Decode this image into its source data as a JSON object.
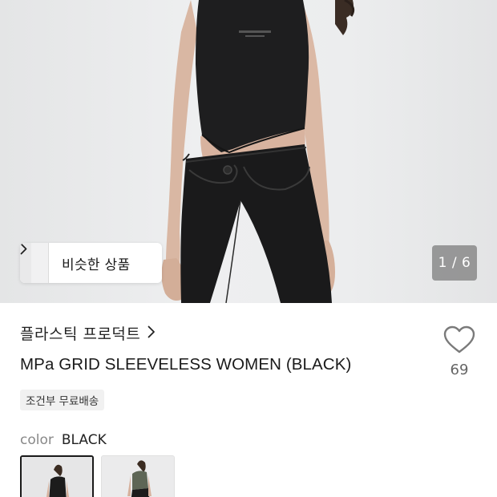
{
  "gallery": {
    "similar_label": "비슷한 상품",
    "pager": "1 / 6"
  },
  "product": {
    "brand": "플라스틱 프로덕트",
    "title": "MPa GRID SLEEVELESS WOMEN (BLACK)",
    "likes": "69",
    "shipping_badge": "조건부 무료배송"
  },
  "options": {
    "color_label": "color",
    "color_value": "BLACK",
    "swatches": [
      "black",
      "khaki"
    ]
  },
  "icons": [
    "chevron-right-icon",
    "heart-icon"
  ],
  "colors": {
    "pager_bg": "#787878",
    "badge_bg": "#f1f1f1",
    "selected_border": "#1a1a1a"
  }
}
